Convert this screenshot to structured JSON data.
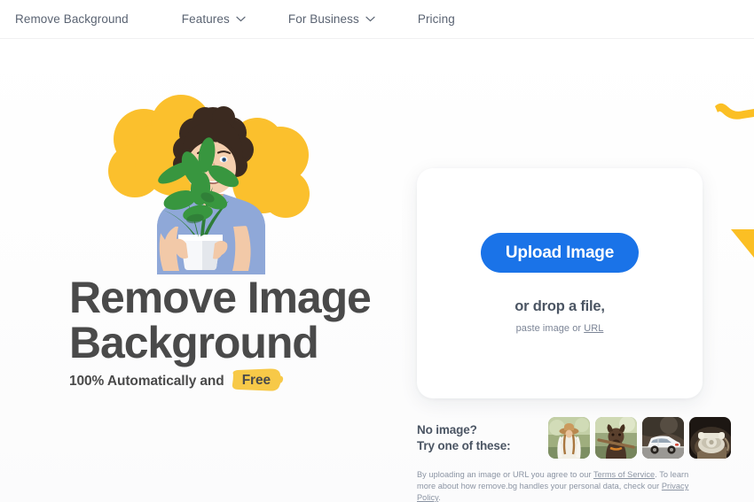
{
  "nav": {
    "items": [
      {
        "label": "Remove Background",
        "has_chevron": false,
        "icon": null
      },
      {
        "label": "Features",
        "has_chevron": true,
        "icon": "chevron-down-icon"
      },
      {
        "label": "For Business",
        "has_chevron": true,
        "icon": "chevron-down-icon"
      },
      {
        "label": "Pricing",
        "has_chevron": false,
        "icon": null
      }
    ]
  },
  "hero": {
    "headline_line1": "Remove Image",
    "headline_line2": "Background",
    "subline_text": "100% Automatically and",
    "subline_highlight": "Free",
    "illustration_alt": "man-with-plant-photo"
  },
  "upload": {
    "button_label": "Upload Image",
    "drop_text": "or drop a file,",
    "paste_prefix": "paste image or ",
    "paste_link": "URL"
  },
  "samples": {
    "label_line1": "No image?",
    "label_line2": "Try one of these:",
    "thumbnails": [
      {
        "name": "sample-woman-hat",
        "alt": "woman in hat in field"
      },
      {
        "name": "sample-dog-stick",
        "alt": "brown dog holding stick"
      },
      {
        "name": "sample-white-car",
        "alt": "white car on road"
      },
      {
        "name": "sample-vintage-phone",
        "alt": "vintage rotary telephone"
      }
    ]
  },
  "legal": {
    "part1": "By uploading an image or URL you agree to our ",
    "link1": "Terms of Service",
    "part2": ". To learn more about how remove.bg handles your personal data, check our ",
    "link2": "Privacy Policy",
    "part3": "."
  },
  "colors": {
    "accent_blue": "#1a73e8",
    "brand_yellow": "#fbbf24",
    "highlight_yellow": "#f7c948",
    "text_dark": "#4a4a4a",
    "text_muted": "#5a6372",
    "page_bg": "#ffffff"
  }
}
